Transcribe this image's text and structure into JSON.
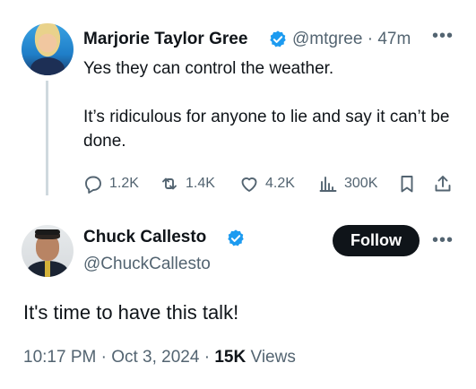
{
  "tweet1": {
    "display_name": "Marjorie Taylor Gree",
    "handle": "@mtgree",
    "separator": "·",
    "time": "47m",
    "text": "Yes they can control the weather.\n\nIt’s ridiculous for anyone to lie and say it can’t be done.",
    "verified_color": "#1d9bf0",
    "actions": {
      "replies": "1.2K",
      "reposts": "1.4K",
      "likes": "4.2K",
      "views": "300K"
    },
    "icons": [
      "more-icon",
      "reply-icon",
      "repost-icon",
      "like-icon",
      "views-icon",
      "bookmark-icon",
      "share-icon"
    ]
  },
  "tweet2": {
    "display_name": "Chuck Callesto",
    "handle": "@ChuckCallesto",
    "follow_label": "Follow",
    "text": "It's time to have this talk!",
    "timestamp": "10:17 PM · Oct 3, 2024",
    "views_count": "15K",
    "views_label": "Views",
    "verified_color": "#1d9bf0"
  }
}
